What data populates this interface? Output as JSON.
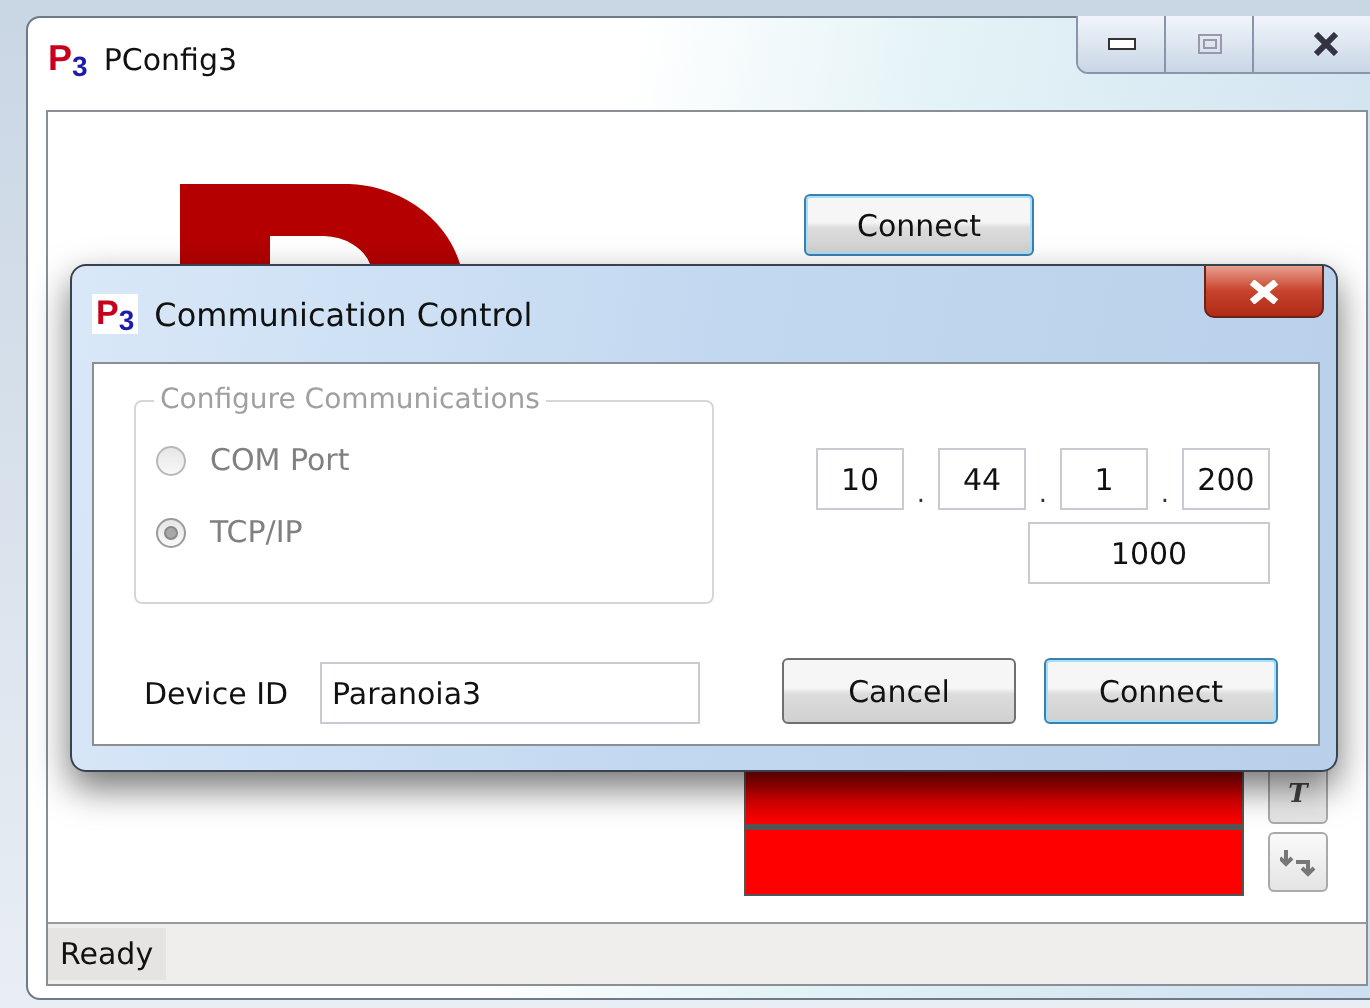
{
  "main_window": {
    "logo": {
      "letter": "P",
      "digit": "3"
    },
    "title": "PConfig3",
    "connect_button": "Connect",
    "tool_buttons": [
      "T"
    ]
  },
  "dialog": {
    "logo": {
      "letter": "P",
      "digit": "3"
    },
    "title": "Communication Control",
    "group_title": "Configure Communications",
    "disabled": true,
    "options": [
      {
        "label": "COM Port",
        "selected": false
      },
      {
        "label": "TCP/IP",
        "selected": true
      }
    ],
    "ip": [
      "10",
      "44",
      "1",
      "200"
    ],
    "ip_separators": [
      ".",
      ".",
      "."
    ],
    "port": "1000",
    "device_id_label": "Device ID",
    "device_id": "Paranoia3",
    "buttons": [
      "Cancel",
      "Connect"
    ]
  },
  "status_bar": "Ready"
}
